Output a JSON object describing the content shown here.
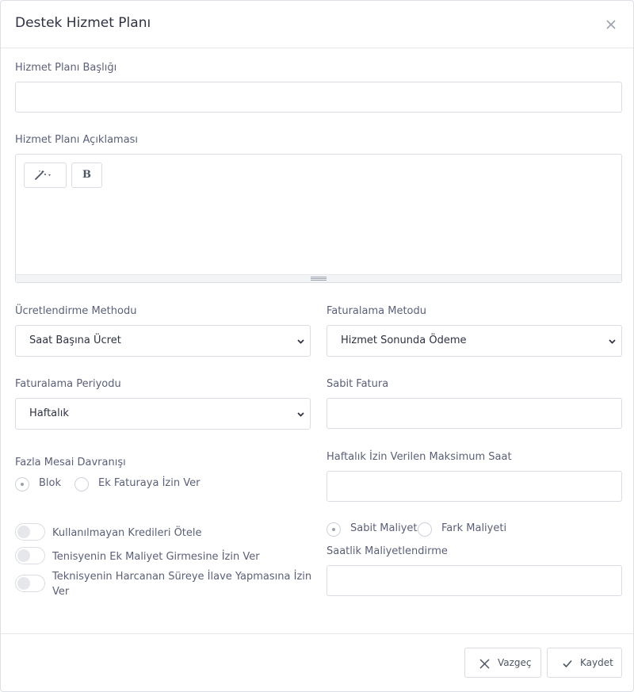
{
  "modal": {
    "title": "Destek Hizmet Planı"
  },
  "form": {
    "plan_title_label": "Hizmet Planı Başlığı",
    "plan_title_value": "",
    "plan_desc_label": "Hizmet Planı Açıklaması",
    "editor": {
      "bold_label": "B",
      "content": ""
    },
    "pricing_method": {
      "label": "Ücretlendirme Methodu",
      "selected": "Saat Başına Ücret"
    },
    "billing_method": {
      "label": "Faturalama Metodu",
      "selected": "Hizmet Sonunda Ödeme"
    },
    "billing_period": {
      "label": "Faturalama Periyodu",
      "selected": "Haftalık"
    },
    "fixed_invoice": {
      "label": "Sabit Fatura",
      "value": ""
    },
    "overtime": {
      "label": "Fazla Mesai Davranışı",
      "options": [
        "Blok",
        "Ek Faturaya İzin Ver"
      ],
      "selected": "Blok"
    },
    "weekly_max_hours": {
      "label": "Haftalık İzin Verilen Maksimum Saat",
      "value": ""
    },
    "toggles": [
      "Kullanılmayan Kredileri Ötele",
      "Tenisyenin Ek Maliyet Girmesine İzin Ver",
      "Teknisyenin Harcanan Süreye İlave Yapmasına İzin Ver"
    ],
    "cost_type": {
      "options": [
        "Sabit Maliyet",
        "Fark Maliyeti"
      ],
      "selected": "Sabit Maliyet"
    },
    "hourly_costing": {
      "label": "Saatlik Maliyetlendirme",
      "value": ""
    }
  },
  "footer": {
    "cancel_label": "Vazgeç",
    "save_label": "Kaydet"
  },
  "colors": {
    "border": "#d9dce3",
    "label": "#5b6078",
    "title": "#2d3142"
  }
}
